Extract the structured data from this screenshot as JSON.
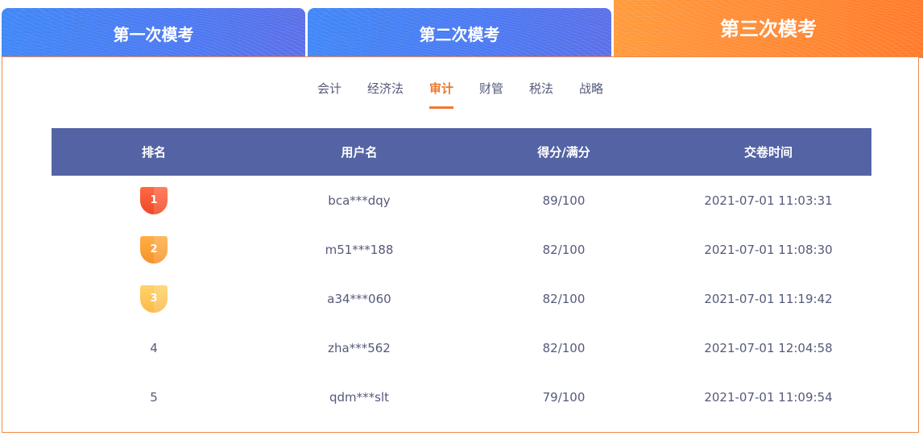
{
  "exam_tabs": [
    {
      "label": "第一次模考",
      "active": false
    },
    {
      "label": "第二次模考",
      "active": false
    },
    {
      "label": "第三次模考",
      "active": true
    }
  ],
  "subjects": [
    {
      "label": "会计",
      "active": false
    },
    {
      "label": "经济法",
      "active": false
    },
    {
      "label": "审计",
      "active": true
    },
    {
      "label": "财管",
      "active": false
    },
    {
      "label": "税法",
      "active": false
    },
    {
      "label": "战略",
      "active": false
    }
  ],
  "table": {
    "headers": {
      "rank": "排名",
      "username": "用户名",
      "score": "得分/满分",
      "time": "交卷时间"
    },
    "rows": [
      {
        "rank": "1",
        "username": "bca***dqy",
        "score": "89/100",
        "time": "2021-07-01 11:03:31"
      },
      {
        "rank": "2",
        "username": "m51***188",
        "score": "82/100",
        "time": "2021-07-01 11:08:30"
      },
      {
        "rank": "3",
        "username": "a34***060",
        "score": "82/100",
        "time": "2021-07-01 11:19:42"
      },
      {
        "rank": "4",
        "username": "zha***562",
        "score": "82/100",
        "time": "2021-07-01 12:04:58"
      },
      {
        "rank": "5",
        "username": "qdm***slt",
        "score": "79/100",
        "time": "2021-07-01 11:09:54"
      }
    ]
  },
  "colors": {
    "tab_blue": "#4a78f2",
    "tab_orange": "#ff8a34",
    "accent": "#f0772f",
    "header_bg": "#5463a4",
    "text": "#555a7a",
    "medal_gold": "#f04826",
    "medal_silver": "#f8922b",
    "medal_bronze": "#fbba4a"
  }
}
